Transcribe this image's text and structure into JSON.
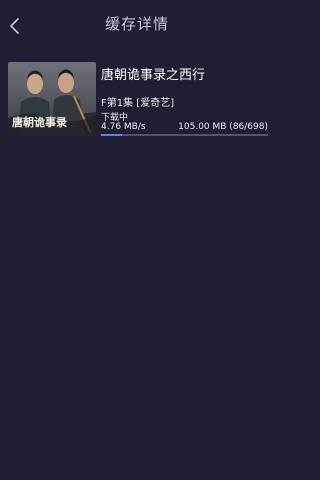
{
  "header": {
    "title": "缓存详情",
    "back_icon": "chevron-left-icon"
  },
  "download_item": {
    "title": "唐朝诡事录之西行",
    "episode": "F第1集 [爱奇艺]",
    "status": "下载中",
    "speed": "4.76 MB/s",
    "progress_text": "105.00 MB (86/698)",
    "progress_fraction": 0.123,
    "progress_color": "#5d7dff",
    "thumbnail_text": "唐朝诡事录"
  },
  "colors": {
    "background": "#1e1f32",
    "accent": "#5d7dff"
  }
}
